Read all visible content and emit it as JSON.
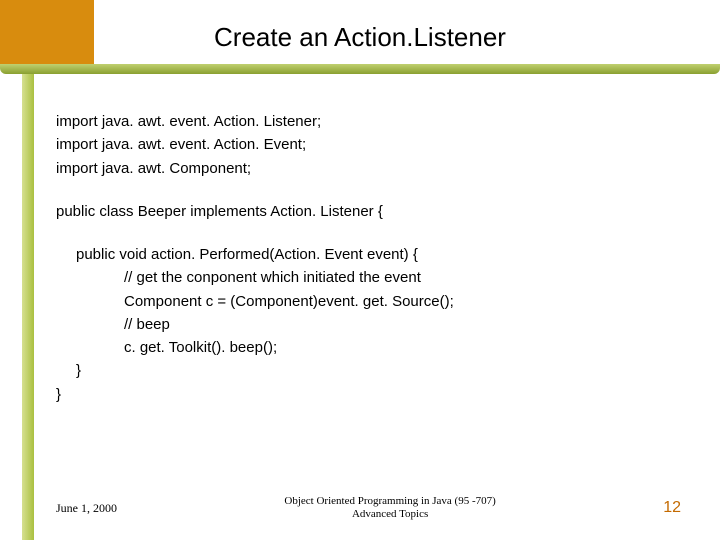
{
  "title": "Create an Action.Listener",
  "imports": [
    "import java. awt. event. Action. Listener;",
    "import java. awt. event. Action. Event;",
    "import java. awt. Component;"
  ],
  "class_decl": "public class Beeper implements Action. Listener {",
  "method_decl": "public void action. Performed(Action. Event event) {",
  "body": [
    "// get the conponent which initiated the event",
    "Component c = (Component)event. get. Source();",
    "// beep",
    "c. get. Toolkit(). beep();"
  ],
  "close_method": "}",
  "close_class": "}",
  "footer": {
    "date": "June 1, 2000",
    "course_line1": "Object Oriented Programming in Java  (95 -707)",
    "course_line2": "Advanced Topics",
    "page": "12"
  }
}
